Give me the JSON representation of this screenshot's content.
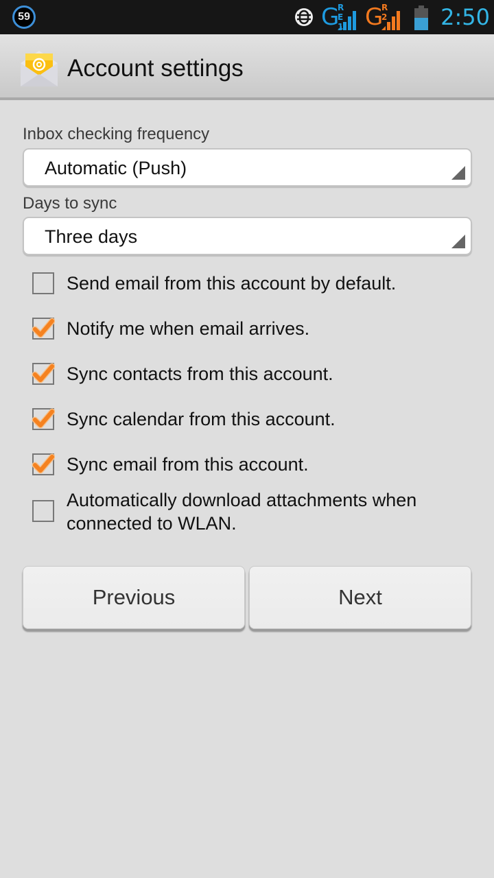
{
  "status_bar": {
    "notification_count": "59",
    "sync_icon": "data-sync-icon",
    "sim1": {
      "network_type": "G",
      "superscript": "R E 1",
      "color": "#1e9be0"
    },
    "sim2": {
      "network_type": "G",
      "superscript": "R 2",
      "color": "#f47a1f"
    },
    "battery_level_percent": 55,
    "battery_color": "#3a9fd4",
    "time": "2:50",
    "time_color": "#33b5e5"
  },
  "action_bar": {
    "icon": "email-envelope-icon",
    "title": "Account settings"
  },
  "settings": {
    "inbox_frequency": {
      "label": "Inbox checking frequency",
      "value": "Automatic (Push)"
    },
    "days_to_sync": {
      "label": "Days to sync",
      "value": "Three days"
    },
    "options": [
      {
        "label": "Send email from this account by default.",
        "checked": false
      },
      {
        "label": "Notify me when email arrives.",
        "checked": true
      },
      {
        "label": "Sync contacts from this account.",
        "checked": true
      },
      {
        "label": "Sync calendar from this account.",
        "checked": true
      },
      {
        "label": "Sync email from this account.",
        "checked": true
      },
      {
        "label": "Automatically download attachments when connected to WLAN.",
        "checked": false
      }
    ],
    "accent_color": "#f58220"
  },
  "buttons": {
    "previous": "Previous",
    "next": "Next"
  }
}
